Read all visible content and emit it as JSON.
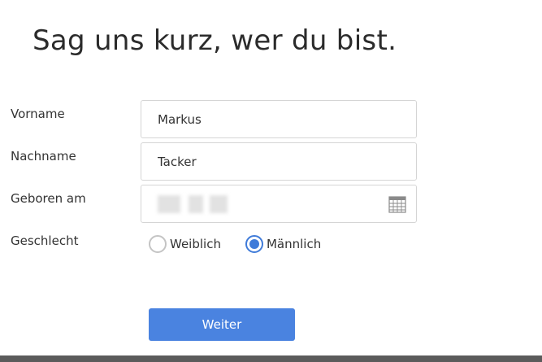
{
  "header": {
    "title": "Sag uns kurz, wer du bist."
  },
  "form": {
    "first_name": {
      "label": "Vorname",
      "value": "Markus"
    },
    "last_name": {
      "label": "Nachname",
      "value": "Tacker"
    },
    "birthdate": {
      "label": "Geboren am",
      "icon": "calendar-icon"
    },
    "gender": {
      "label": "Geschlecht",
      "options": [
        "Weiblich",
        "Männlich"
      ],
      "selected": "Männlich"
    },
    "submit_label": "Weiter"
  },
  "colors": {
    "accent": "#4a83e0",
    "radio_selected": "#3f7bd9",
    "bottom_bar": "#5b5b5b"
  }
}
